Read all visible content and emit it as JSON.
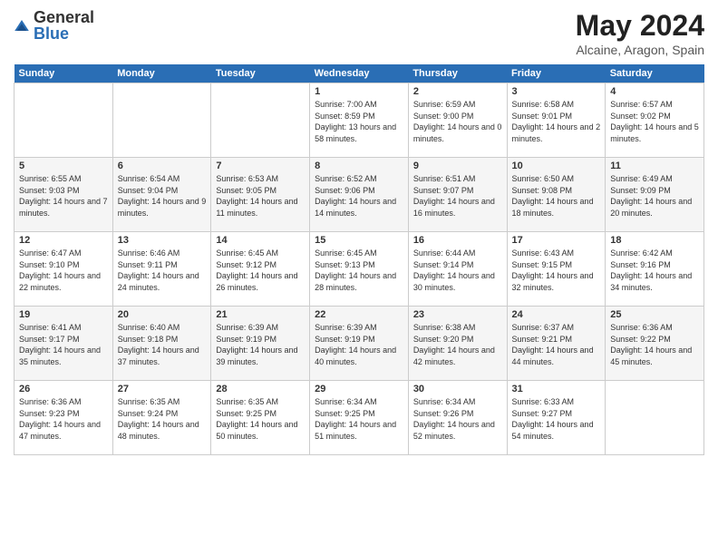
{
  "logo": {
    "general": "General",
    "blue": "Blue"
  },
  "title": "May 2024",
  "subtitle": "Alcaine, Aragon, Spain",
  "days": [
    "Sunday",
    "Monday",
    "Tuesday",
    "Wednesday",
    "Thursday",
    "Friday",
    "Saturday"
  ],
  "weeks": [
    {
      "alt": false,
      "cells": [
        {
          "date": "",
          "sunrise": "",
          "sunset": "",
          "daylight": ""
        },
        {
          "date": "",
          "sunrise": "",
          "sunset": "",
          "daylight": ""
        },
        {
          "date": "",
          "sunrise": "",
          "sunset": "",
          "daylight": ""
        },
        {
          "date": "1",
          "sunrise": "Sunrise: 7:00 AM",
          "sunset": "Sunset: 8:59 PM",
          "daylight": "Daylight: 13 hours and 58 minutes."
        },
        {
          "date": "2",
          "sunrise": "Sunrise: 6:59 AM",
          "sunset": "Sunset: 9:00 PM",
          "daylight": "Daylight: 14 hours and 0 minutes."
        },
        {
          "date": "3",
          "sunrise": "Sunrise: 6:58 AM",
          "sunset": "Sunset: 9:01 PM",
          "daylight": "Daylight: 14 hours and 2 minutes."
        },
        {
          "date": "4",
          "sunrise": "Sunrise: 6:57 AM",
          "sunset": "Sunset: 9:02 PM",
          "daylight": "Daylight: 14 hours and 5 minutes."
        }
      ]
    },
    {
      "alt": true,
      "cells": [
        {
          "date": "5",
          "sunrise": "Sunrise: 6:55 AM",
          "sunset": "Sunset: 9:03 PM",
          "daylight": "Daylight: 14 hours and 7 minutes."
        },
        {
          "date": "6",
          "sunrise": "Sunrise: 6:54 AM",
          "sunset": "Sunset: 9:04 PM",
          "daylight": "Daylight: 14 hours and 9 minutes."
        },
        {
          "date": "7",
          "sunrise": "Sunrise: 6:53 AM",
          "sunset": "Sunset: 9:05 PM",
          "daylight": "Daylight: 14 hours and 11 minutes."
        },
        {
          "date": "8",
          "sunrise": "Sunrise: 6:52 AM",
          "sunset": "Sunset: 9:06 PM",
          "daylight": "Daylight: 14 hours and 14 minutes."
        },
        {
          "date": "9",
          "sunrise": "Sunrise: 6:51 AM",
          "sunset": "Sunset: 9:07 PM",
          "daylight": "Daylight: 14 hours and 16 minutes."
        },
        {
          "date": "10",
          "sunrise": "Sunrise: 6:50 AM",
          "sunset": "Sunset: 9:08 PM",
          "daylight": "Daylight: 14 hours and 18 minutes."
        },
        {
          "date": "11",
          "sunrise": "Sunrise: 6:49 AM",
          "sunset": "Sunset: 9:09 PM",
          "daylight": "Daylight: 14 hours and 20 minutes."
        }
      ]
    },
    {
      "alt": false,
      "cells": [
        {
          "date": "12",
          "sunrise": "Sunrise: 6:47 AM",
          "sunset": "Sunset: 9:10 PM",
          "daylight": "Daylight: 14 hours and 22 minutes."
        },
        {
          "date": "13",
          "sunrise": "Sunrise: 6:46 AM",
          "sunset": "Sunset: 9:11 PM",
          "daylight": "Daylight: 14 hours and 24 minutes."
        },
        {
          "date": "14",
          "sunrise": "Sunrise: 6:45 AM",
          "sunset": "Sunset: 9:12 PM",
          "daylight": "Daylight: 14 hours and 26 minutes."
        },
        {
          "date": "15",
          "sunrise": "Sunrise: 6:45 AM",
          "sunset": "Sunset: 9:13 PM",
          "daylight": "Daylight: 14 hours and 28 minutes."
        },
        {
          "date": "16",
          "sunrise": "Sunrise: 6:44 AM",
          "sunset": "Sunset: 9:14 PM",
          "daylight": "Daylight: 14 hours and 30 minutes."
        },
        {
          "date": "17",
          "sunrise": "Sunrise: 6:43 AM",
          "sunset": "Sunset: 9:15 PM",
          "daylight": "Daylight: 14 hours and 32 minutes."
        },
        {
          "date": "18",
          "sunrise": "Sunrise: 6:42 AM",
          "sunset": "Sunset: 9:16 PM",
          "daylight": "Daylight: 14 hours and 34 minutes."
        }
      ]
    },
    {
      "alt": true,
      "cells": [
        {
          "date": "19",
          "sunrise": "Sunrise: 6:41 AM",
          "sunset": "Sunset: 9:17 PM",
          "daylight": "Daylight: 14 hours and 35 minutes."
        },
        {
          "date": "20",
          "sunrise": "Sunrise: 6:40 AM",
          "sunset": "Sunset: 9:18 PM",
          "daylight": "Daylight: 14 hours and 37 minutes."
        },
        {
          "date": "21",
          "sunrise": "Sunrise: 6:39 AM",
          "sunset": "Sunset: 9:19 PM",
          "daylight": "Daylight: 14 hours and 39 minutes."
        },
        {
          "date": "22",
          "sunrise": "Sunrise: 6:39 AM",
          "sunset": "Sunset: 9:19 PM",
          "daylight": "Daylight: 14 hours and 40 minutes."
        },
        {
          "date": "23",
          "sunrise": "Sunrise: 6:38 AM",
          "sunset": "Sunset: 9:20 PM",
          "daylight": "Daylight: 14 hours and 42 minutes."
        },
        {
          "date": "24",
          "sunrise": "Sunrise: 6:37 AM",
          "sunset": "Sunset: 9:21 PM",
          "daylight": "Daylight: 14 hours and 44 minutes."
        },
        {
          "date": "25",
          "sunrise": "Sunrise: 6:36 AM",
          "sunset": "Sunset: 9:22 PM",
          "daylight": "Daylight: 14 hours and 45 minutes."
        }
      ]
    },
    {
      "alt": false,
      "cells": [
        {
          "date": "26",
          "sunrise": "Sunrise: 6:36 AM",
          "sunset": "Sunset: 9:23 PM",
          "daylight": "Daylight: 14 hours and 47 minutes."
        },
        {
          "date": "27",
          "sunrise": "Sunrise: 6:35 AM",
          "sunset": "Sunset: 9:24 PM",
          "daylight": "Daylight: 14 hours and 48 minutes."
        },
        {
          "date": "28",
          "sunrise": "Sunrise: 6:35 AM",
          "sunset": "Sunset: 9:25 PM",
          "daylight": "Daylight: 14 hours and 50 minutes."
        },
        {
          "date": "29",
          "sunrise": "Sunrise: 6:34 AM",
          "sunset": "Sunset: 9:25 PM",
          "daylight": "Daylight: 14 hours and 51 minutes."
        },
        {
          "date": "30",
          "sunrise": "Sunrise: 6:34 AM",
          "sunset": "Sunset: 9:26 PM",
          "daylight": "Daylight: 14 hours and 52 minutes."
        },
        {
          "date": "31",
          "sunrise": "Sunrise: 6:33 AM",
          "sunset": "Sunset: 9:27 PM",
          "daylight": "Daylight: 14 hours and 54 minutes."
        },
        {
          "date": "",
          "sunrise": "",
          "sunset": "",
          "daylight": ""
        }
      ]
    }
  ]
}
